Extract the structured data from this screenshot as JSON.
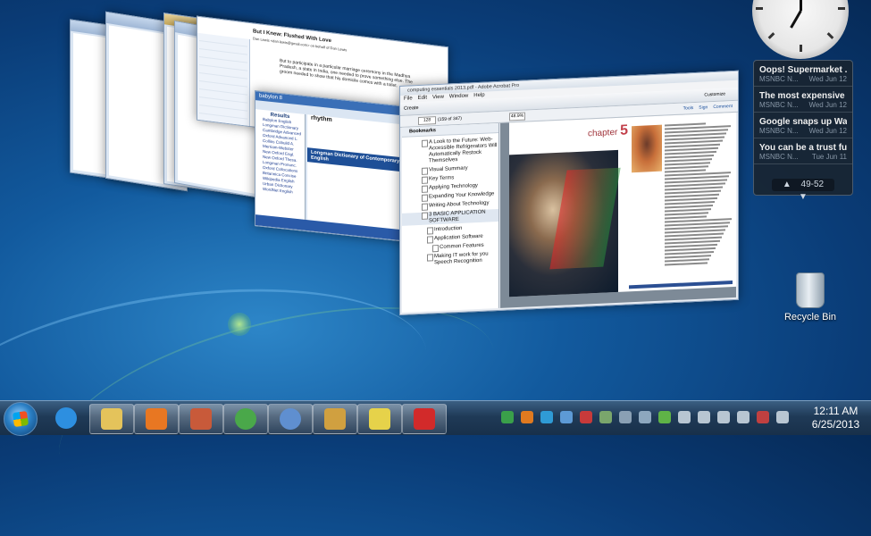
{
  "windows": {
    "email": {
      "title": "But I Knew: Flushed With Love",
      "from": "Dan Lewis <dan.lewis@gmail.com> on behalf of Dan Lewis",
      "body": "But to participate in a particular marriage ceremony in the Madhya Pradesh, a state in India, one needed to prove something else. The groom needed to show that his domicile comes with a toilet."
    },
    "babylon": {
      "title": "babylon 8",
      "results_label": "Results",
      "results": [
        "Babylon English",
        "Longman Dictionary",
        "Cambridge Advanced",
        "Oxford Advanced L.",
        "Collins Cobuild A.",
        "Merriam-Webster",
        "New Oxford Engl.",
        "New Oxford Thesa.",
        "Longman Pronunc.",
        "Oxford Collocations",
        "Britannica Concise",
        "Wikipedia English",
        "Urban Dictionary",
        "WordNet English"
      ],
      "word": "rhythm",
      "section": "Longman Dictionary of Contemporary English"
    },
    "acrobat": {
      "title": "computing essentials 2013.pdf - Adobe Acrobat Pro",
      "menu": [
        "File",
        "Edit",
        "View",
        "Window",
        "Help"
      ],
      "create_label": "Create",
      "page_value": "128",
      "page_count": "(159 of 347)",
      "zoom_value": "48.9%",
      "tools_links": [
        "Tools",
        "Sign",
        "Comment"
      ],
      "customize": "Customize",
      "bookmarks_label": "Bookmarks",
      "bookmarks": [
        {
          "label": "A Look to the Future: Web-Accessible Refrigerators Will Automatically Restock Themselves",
          "level": 0
        },
        {
          "label": "Visual Summary",
          "level": 0
        },
        {
          "label": "Key Terms",
          "level": 0
        },
        {
          "label": "Applying Technology",
          "level": 0
        },
        {
          "label": "Expanding Your Knowledge",
          "level": 0
        },
        {
          "label": "Writing About Technology",
          "level": 0
        },
        {
          "label": "3 BASIC APPLICATION SOFTWARE",
          "level": 0,
          "selected": true
        },
        {
          "label": "Introduction",
          "level": 1
        },
        {
          "label": "Application Software",
          "level": 1
        },
        {
          "label": "Common Features",
          "level": 2
        },
        {
          "label": "Making IT work for you Speech Recognition",
          "level": 1
        }
      ],
      "chapter_word": "chapter",
      "chapter_num": "5"
    }
  },
  "gadgets": {
    "news": [
      {
        "title": "Oops! Supermarket ...",
        "source": "MSNBC N...",
        "date": "Wed Jun 12"
      },
      {
        "title": "The most expensive ...",
        "source": "MSNBC N...",
        "date": "Wed Jun 12"
      },
      {
        "title": "Google snaps up Wa...",
        "source": "MSNBC N...",
        "date": "Wed Jun 12"
      },
      {
        "title": "You can be a trust fu...",
        "source": "MSNBC N...",
        "date": "Tue Jun 11"
      }
    ],
    "news_nav": "49-52",
    "news_prev": "▲",
    "news_next": "▼"
  },
  "desktop": {
    "recycle_bin_label": "Recycle Bin"
  },
  "taskbar": {
    "time": "12:11 AM",
    "date": "6/25/2013",
    "pinned": [
      {
        "name": "internet-explorer",
        "color": "#2d8fe0"
      },
      {
        "name": "windows-explorer",
        "color": "#e4c35b"
      },
      {
        "name": "media-player",
        "color": "#e87722"
      },
      {
        "name": "paint",
        "color": "#c85a3a"
      },
      {
        "name": "chrome",
        "color": "#4aa84a"
      },
      {
        "name": "babylon",
        "color": "#5f8fd0"
      },
      {
        "name": "outlook",
        "color": "#d0a040"
      },
      {
        "name": "sticky-notes",
        "color": "#e6d24a"
      },
      {
        "name": "adobe-acrobat",
        "color": "#d22a2a"
      }
    ],
    "tray": [
      {
        "name": "shield-tray",
        "color": "#3aa04a"
      },
      {
        "name": "office-tray",
        "color": "#e07a20"
      },
      {
        "name": "skype-tray",
        "color": "#2f9bd6"
      },
      {
        "name": "arrow-tray",
        "color": "#5d9ad6"
      },
      {
        "name": "v-tray",
        "color": "#c73a3a"
      },
      {
        "name": "network-tray",
        "color": "#7aa66c"
      },
      {
        "name": "monitor-tray",
        "color": "#8aa0b4"
      },
      {
        "name": "people-tray",
        "color": "#8da7be"
      },
      {
        "name": "green-tray",
        "color": "#5fb347"
      },
      {
        "name": "battery-tray",
        "color": "#b8c6d2"
      },
      {
        "name": "volume-tray",
        "color": "#b8c6d2"
      },
      {
        "name": "users-tray",
        "color": "#b8c6d2"
      },
      {
        "name": "headset-tray",
        "color": "#b8c6d2"
      },
      {
        "name": "flag-tray",
        "color": "#c04040"
      },
      {
        "name": "desktop-tray",
        "color": "#b8c6d2"
      }
    ]
  }
}
